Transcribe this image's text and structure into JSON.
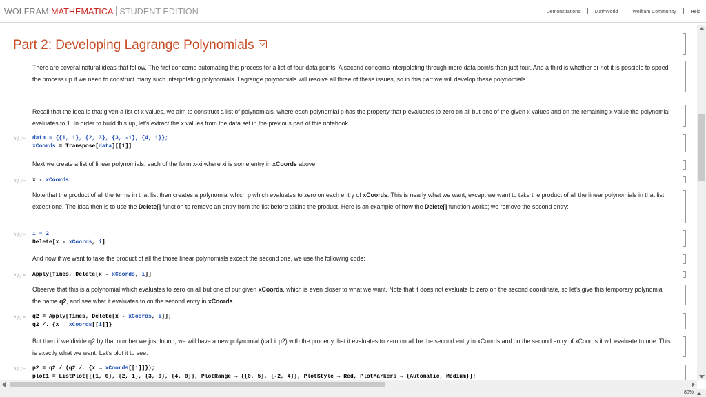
{
  "header": {
    "brand_main": "WOLFRAM",
    "brand_accent": "MATHEMATICA",
    "brand_sub": "STUDENT EDITION",
    "links": [
      "Demonstrations",
      "MathWorld",
      "Wolfram Community",
      "Help"
    ]
  },
  "colors": {
    "title": "#c64c25",
    "brand_red": "#c8261f",
    "code_blue": "#1f50b5"
  },
  "section": {
    "title": "Part 2: Developing Lagrange Polynomials"
  },
  "cells": {
    "p1": "There are several natural ideas that follow. The first concerns automating this process for a list of four data points. A second concerns interpolating through more data points than just four. And a third is whether or not it is possible to speed the process up if we need to construct many such interpolating polynomials. Lagrange polynomials will resolve all three of these issues, so in this part we will develop these polynomials.",
    "p2": "Recall that the idea is that given a list of x values, we aim to construct a list of polynomials, where each polynomial p has the property that p evaluates to zero on all but one of the given x values and on the remaining x value the polynomial evaluates to 1. In order to build this up, let's extract the x values from the data set in the previous part of this notebook.",
    "in_label": "In[-]:=",
    "c1_line1": "data = {{1, 1}, {2, 3}, {3, -1}, {4, 1}};",
    "c1_line2a": "xCoords",
    "c1_line2b": " = Transpose[",
    "c1_line2c": "data",
    "c1_line2d": "][[1]]",
    "p3a": "Next we create a list of linear polynomials, each of the form x-xi where xi is some entry in ",
    "p3b": "xCoords",
    "p3c": " above.",
    "c2a": "x - ",
    "c2b": "xCoords",
    "p4a": "Note that the product of all the terms in that list then creates a polynomial which p which evaluates to zero on each entry of ",
    "p4b": "xCoords",
    "p4c": ". This is nearly what we want, except we want to take the product of all the linear polynomials in that list except one. The idea then is to use the ",
    "p4d": "Delete[]",
    "p4e": " function to remove an entry from the list before taking the product. Here is an example of how the ",
    "p4f": "Delete[]",
    "p4g": " function works; we remove the second entry:",
    "c3_line1": "i = 2",
    "c3a": "Delete[x - ",
    "c3b": "xCoords",
    "c3c": ", ",
    "c3d": "i",
    "c3e": "]",
    "p5": "And now if we want to take the product of all the those linear polynomials except the second one, we use the following code:",
    "c4a": "Apply[Times, Delete[x - ",
    "c4b": "xCoords",
    "c4c": ", ",
    "c4d": "i",
    "c4e": "]]",
    "p6a": "Observe that this is a polynomial which evaluates to zero on all but one of our given ",
    "p6b": "xCoords",
    "p6c": ", which is even closer to what we want. Note that it does not evaluate to zero on the second coordinate, so let's give this temporary polynomial the name ",
    "p6d": "q2",
    "p6e": ", and see what it evaluates to on the second entry in ",
    "p6f": "xCoords",
    "p6g": ".",
    "c5_l1a": "q2 = Apply[Times, Delete[x - ",
    "c5_l1b": "xCoords",
    "c5_l1c": ", ",
    "c5_l1d": "i",
    "c5_l1e": "]];",
    "c5_l2a": "q2 /. {x → ",
    "c5_l2b": "xCoords",
    "c5_l2c": "[[",
    "c5_l2d": "i",
    "c5_l2e": "]]}",
    "p7": "But then if we divide q2 by that number we just found, we will have a new polynomial (call it p2) with the property that it evaluates to zero on all be the second entry in xCoords and on the second entry of xCoords it will evaluate to one. This is exactly what we want. Let's plot it to see.",
    "c6_l1a": "p2 = q2 / (q2 /. {x → ",
    "c6_l1b": "xCoords",
    "c6_l1c": "[[",
    "c6_l1d": "i",
    "c6_l1e": "]]});",
    "c6_l2": "plot1 = ListPlot[{{1, 0}, {2, 1}, {3, 0}, {4, 0}}, PlotRange → {{0, 5}, {-2, 4}}, PlotStyle → Red, PlotMarkers → {Automatic, Medium}];"
  },
  "status": {
    "zoom": "80%"
  }
}
